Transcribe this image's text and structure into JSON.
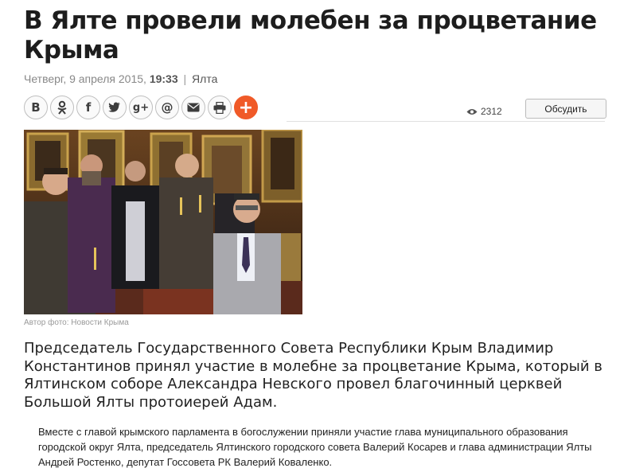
{
  "article": {
    "title": "В Ялте провели молебен за процветание Крыма",
    "date": "Четверг, 9 апреля 2015,",
    "time": "19:33",
    "separator": "|",
    "location": "Ялта",
    "photo_caption": "Автор фото: Новости Крыма",
    "lead": "Председатель Государственного Совета Республики Крым Владимир Константинов принял участие в молебне за процветание Крыма, который в Ялтинском соборе Александра Невского провел благочинный церквей Большой Ялты протоиерей Адам.",
    "body": "Вместе с главой крымского парламента в богослужении приняли участие глава муниципального образования городской округ Ялта, председатель Ялтинского городского совета Валерий Косарев и глава администрации Ялты Андрей Ростенко, депутат Госсовета РК Валерий Коваленко."
  },
  "share": {
    "buttons": [
      {
        "icon": "vk-icon",
        "glyph": "В"
      },
      {
        "icon": "odnoklassniki-icon",
        "glyph": "ok"
      },
      {
        "icon": "facebook-icon",
        "glyph": "f"
      },
      {
        "icon": "twitter-icon",
        "glyph": "t"
      },
      {
        "icon": "google-plus-icon",
        "glyph": "g+"
      },
      {
        "icon": "mail-at-icon",
        "glyph": "@"
      },
      {
        "icon": "email-icon",
        "glyph": "✉"
      },
      {
        "icon": "print-icon",
        "glyph": "🖶"
      },
      {
        "icon": "more-plus-icon",
        "glyph": "+"
      }
    ]
  },
  "stats": {
    "views_icon": "eye-icon",
    "views": "2312",
    "discuss_label": "Обсудить"
  },
  "colors": {
    "title": "#1d1d1d",
    "meta": "#888888",
    "accent": "#f05a28"
  }
}
